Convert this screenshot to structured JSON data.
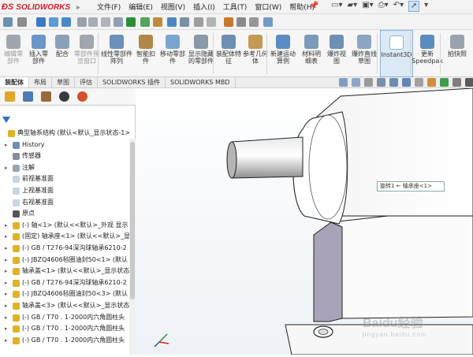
{
  "app": {
    "name": "SOLIDWORKS"
  },
  "menu": [
    "文件(F)",
    "编辑(E)",
    "视图(V)",
    "插入(I)",
    "工具(T)",
    "窗口(W)",
    "帮助(H)"
  ],
  "ribbon": [
    {
      "label": "编辑零部件",
      "dim": true
    },
    {
      "label": "插入零部件",
      "dim": false
    },
    {
      "label": "配合",
      "dim": false
    },
    {
      "label": "零部件预览窗口",
      "dim": true
    },
    {
      "label": "线性零部件阵列",
      "dim": false
    },
    {
      "label": "智能扣件",
      "dim": false
    },
    {
      "label": "移动零部件",
      "dim": false
    },
    {
      "label": "显示隐藏的零部件",
      "dim": false
    },
    {
      "label": "装配体特征",
      "dim": false
    },
    {
      "label": "参考几何体",
      "dim": false
    },
    {
      "label": "新建运动算例",
      "dim": false
    },
    {
      "label": "材料明细表",
      "dim": false
    },
    {
      "label": "爆炸视图",
      "dim": false
    },
    {
      "label": "爆炸直线草图",
      "dim": false
    },
    {
      "label": "Instant3D",
      "dim": false,
      "active": true
    },
    {
      "label": "更新Speedpak",
      "dim": false
    },
    {
      "label": "拍快照",
      "dim": false
    }
  ],
  "tabs": [
    "装配体",
    "布局",
    "草图",
    "评估",
    "SOLIDWORKS 插件",
    "SOLIDWORKS MBD"
  ],
  "tree": [
    {
      "label": "典型轴系结构 (默认<默认_显示状态-1>)",
      "indent": 0,
      "arrow": false,
      "color": "#e0b227"
    },
    {
      "label": "History",
      "indent": 1,
      "arrow": true,
      "color": "#6b8fb8"
    },
    {
      "label": "传感器",
      "indent": 1,
      "arrow": false,
      "color": "#7f8fa0"
    },
    {
      "label": "注解",
      "indent": 1,
      "arrow": true,
      "color": "#9aa7b3"
    },
    {
      "label": "前视基准面",
      "indent": 1,
      "arrow": false,
      "color": "#c9d6e3"
    },
    {
      "label": "上视基准面",
      "indent": 1,
      "arrow": false,
      "color": "#c9d6e3"
    },
    {
      "label": "右视基准面",
      "indent": 1,
      "arrow": false,
      "color": "#c9d6e3"
    },
    {
      "label": "原点",
      "indent": 1,
      "arrow": false,
      "color": "#555555"
    },
    {
      "label": "(-) 轴<1> (默认<<默认>_外观 显示",
      "indent": 1,
      "arrow": true,
      "color": "#e0b227"
    },
    {
      "label": "(固定) 轴承座<1> (默认<<默认>_显",
      "indent": 1,
      "arrow": true,
      "color": "#e0b227"
    },
    {
      "label": "(-) GB / T276-94深沟球轴承6210-2",
      "indent": 1,
      "arrow": true,
      "color": "#e0b227"
    },
    {
      "label": "(-) JBZQ4606毡圈油封50<1> (默认",
      "indent": 1,
      "arrow": true,
      "color": "#e0b227"
    },
    {
      "label": "轴承盖<1> (默认<<默认>_显示状态",
      "indent": 1,
      "arrow": true,
      "color": "#e0b227"
    },
    {
      "label": "(-) GB / T276-94深沟球轴承6210-2",
      "indent": 1,
      "arrow": true,
      "color": "#e0b227"
    },
    {
      "label": "(-) JBZQ4606毡圈油封50<3> (默认",
      "indent": 1,
      "arrow": true,
      "color": "#e0b227"
    },
    {
      "label": "轴承盖<3> (默认<<默认>_显示状态",
      "indent": 1,
      "arrow": true,
      "color": "#e0b227"
    },
    {
      "label": "(-) GB / T70 . 1-2000内六角圆柱头",
      "indent": 1,
      "arrow": true,
      "color": "#e0b227"
    },
    {
      "label": "(-) GB / T70 . 1-2000内六角圆柱头",
      "indent": 1,
      "arrow": true,
      "color": "#e0b227"
    },
    {
      "label": "(-) GB / T70 . 1-2000内六角圆柱头",
      "indent": 1,
      "arrow": true,
      "color": "#e0b227"
    }
  ],
  "tooltip": "旋转1 ← 轴承座<1>",
  "watermark": {
    "main": "Baidu经验",
    "sub": "jingyan.baidu.com"
  },
  "colors": {
    "brand": "#d51d2b",
    "selection": "#cfe2f7",
    "part_face": "#f5f5f5",
    "part_shadow": "#a9a3b7"
  }
}
